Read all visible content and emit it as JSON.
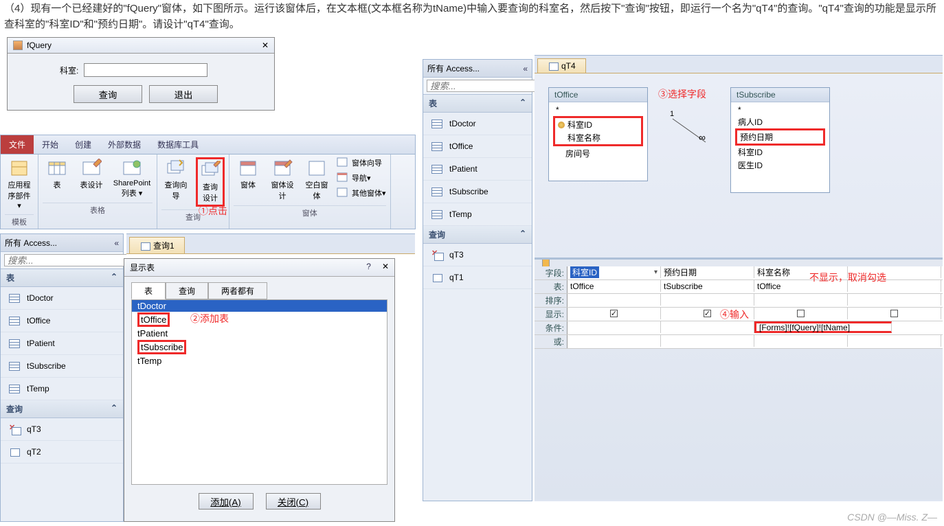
{
  "problem": {
    "line1": "（4）现有一个已经建好的\"fQuery\"窗体，如下图所示。运行该窗体后，在文本框(文本框名称为tName)中输入要查询的科室名，然后按下\"查询\"按钮，即运行一个名为\"qT4\"的查询。\"qT4\"查询的功能是显示所查科室的\"科室ID\"和\"预约日期\"。请设计\"qT4\"查询。"
  },
  "fquery": {
    "title": "fQuery",
    "close": "✕",
    "label": "科室:",
    "btn_query": "查询",
    "btn_exit": "退出"
  },
  "ribbon": {
    "tabs": [
      "文件",
      "开始",
      "创建",
      "外部数据",
      "数据库工具"
    ],
    "active_tab": "创建",
    "groups": {
      "template": {
        "name": "模板",
        "items": [
          {
            "label": "应用程序部件 ▾"
          }
        ]
      },
      "tables": {
        "name": "表格",
        "items": [
          {
            "label": "表"
          },
          {
            "label": "表设计"
          },
          {
            "label": "SharePoint 列表 ▾"
          }
        ]
      },
      "query": {
        "name": "查询",
        "items": [
          {
            "label": "查询向导"
          },
          {
            "label": "查询设计"
          }
        ]
      },
      "forms": {
        "name": "窗体",
        "items": [
          {
            "label": "窗体"
          },
          {
            "label": "窗体设计"
          },
          {
            "label": "空白窗体"
          },
          {
            "label": "窗体向导"
          },
          {
            "label": "导航▾"
          },
          {
            "label": "其他窗体▾"
          }
        ]
      }
    },
    "annot1": "①点击"
  },
  "nav": {
    "title": "所有 Access...",
    "expand": "«",
    "search_ph": "搜索...",
    "sect_tables": "表",
    "sect_queries": "查询",
    "sect_collapse": "⌃",
    "tables": [
      "tDoctor",
      "tOffice",
      "tPatient",
      "tSubscribe",
      "tTemp"
    ],
    "queries_left": [
      "qT3",
      "qT2"
    ],
    "queries_right": [
      "qT3",
      "qT1"
    ]
  },
  "doctab_left": {
    "title": "查询1"
  },
  "showtable": {
    "title": "显示表",
    "q": "?",
    "x": "✕",
    "tabs": [
      "表",
      "查询",
      "两者都有"
    ],
    "list": [
      "tDoctor",
      "tOffice",
      "tPatient",
      "tSubscribe",
      "tTemp"
    ],
    "btn_add": "添加(A)",
    "btn_close": "关闭(C)",
    "annot2": "②添加表"
  },
  "right": {
    "tab_title": "qT4",
    "tOffice": {
      "name": "tOffice",
      "fields": [
        "*",
        "科室ID",
        "科室名称",
        "房间号"
      ]
    },
    "tSubscribe": {
      "name": "tSubscribe",
      "fields": [
        "*",
        "病人ID",
        "预约日期",
        "科室ID",
        "医生ID"
      ]
    },
    "annot3": "③选择字段",
    "qbe": {
      "labels": {
        "field": "字段:",
        "table": "表:",
        "sort": "排序:",
        "show": "显示:",
        "criteria": "条件:",
        "or": "或:"
      },
      "cols": [
        {
          "field": "科室ID",
          "table": "tOffice",
          "show": true,
          "criteria": "",
          "dd": true
        },
        {
          "field": "预约日期",
          "table": "tSubscribe",
          "show": true,
          "criteria": ""
        },
        {
          "field": "科室名称",
          "table": "tOffice",
          "show": false,
          "criteria": "[Forms]![fQuery]![tName]"
        }
      ],
      "annot4": "④输入",
      "annot_noshow": "不显示，取消勾选"
    }
  },
  "watermark": "CSDN @—Miss. Z—"
}
